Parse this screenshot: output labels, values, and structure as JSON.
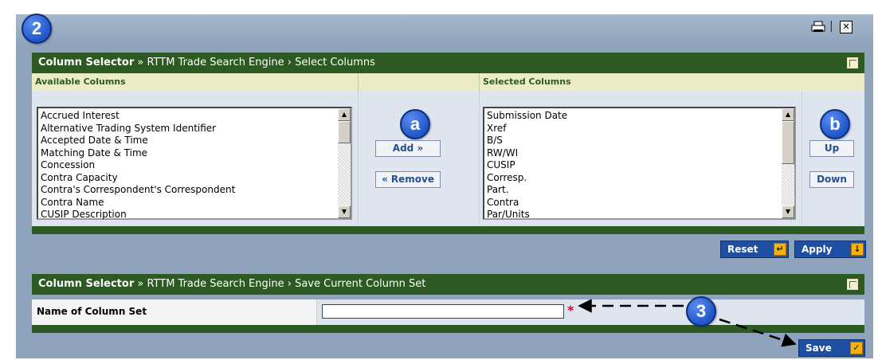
{
  "callouts": {
    "step2": "2",
    "a": "a",
    "b": "b",
    "step3": "3"
  },
  "window": {
    "print_icon": "printer-icon",
    "close_icon": "close-icon",
    "close_glyph": "✕",
    "separator": "|"
  },
  "selector": {
    "title_bold": "Column Selector",
    "title_sep": " » ",
    "title_path": "RTTM Trade Search Engine › Select Columns",
    "available_header": "Available Columns",
    "selected_header": "Selected Columns",
    "available_items": [
      "Accrued Interest",
      "Alternative Trading System Identifier",
      "Accepted Date & Time",
      "Matching Date & Time",
      "Concession",
      "Contra Capacity",
      "Contra's Correspondent's Correspondent",
      "Contra Name",
      "CUSIP Description"
    ],
    "selected_items": [
      "Submission Date",
      "Xref",
      "B/S",
      "RW/WI",
      "CUSIP",
      "Corresp.",
      "Part.",
      "Contra",
      "Par/Units"
    ],
    "add_label": "Add »",
    "remove_label": "« Remove",
    "up_label": "Up",
    "down_label": "Down"
  },
  "actions": {
    "reset_label": "Reset",
    "apply_label": "Apply"
  },
  "save_section": {
    "title_bold": "Column Selector",
    "title_sep": " » ",
    "title_path": "RTTM Trade Search Engine › Save Current Column Set",
    "name_label": "Name of Column Set",
    "name_value": "",
    "required_mark": "*",
    "save_label": "Save"
  },
  "colors": {
    "accent_green": "#2d5a22",
    "button_blue": "#1f4fa3",
    "callout_blue": "#1f55c8",
    "frame": "#8fa4bc"
  }
}
